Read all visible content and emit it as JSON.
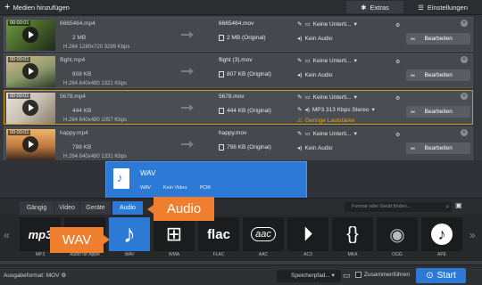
{
  "toolbar": {
    "add_media_label": "Medien hinzufügen",
    "extras_label": "Extras",
    "settings_label": "Einstellungen"
  },
  "files": [
    {
      "duration": "00:00:01",
      "source_name": "6665464.mp4",
      "source_size": "2 MB",
      "source_info": "H.264 1280x720 3299 Kbps",
      "output_name": "6665464.mov",
      "output_size": "2 MB (Original)",
      "subtitle": "Keine Unterti...",
      "audio": "Kein Audio",
      "edit_label": "Bearbeiten",
      "thumb_colors": [
        "#6f9a3a",
        "#1d2a1a"
      ]
    },
    {
      "duration": "00:00:01",
      "source_name": "flight.mp4",
      "source_size": "808 KB",
      "source_info": "H.264 640x480 1321 Kbps",
      "output_name": "flight (3).mov",
      "output_size": "807 KB (Original)",
      "subtitle": "Keine Unterti...",
      "audio": "Kein Audio",
      "edit_label": "Bearbeiten",
      "thumb_colors": [
        "#d7b88a",
        "#2c3b2a"
      ]
    },
    {
      "duration": "00:00:01",
      "source_name": "5678.mp4",
      "source_size": "444 KB",
      "source_info": "H.264 640x480 1057 Kbps",
      "output_name": "5678.mov",
      "output_size": "444 KB (Original)",
      "subtitle": "Keine Unterti...",
      "audio": "MP3 313 Kbps Stereo",
      "warning": "Geringe Lautstärke",
      "edit_label": "Bearbeiten",
      "thumb_colors": [
        "#e9e4dc",
        "#8a7a6a"
      ]
    },
    {
      "duration": "00:00:01",
      "source_name": "happy.mp4",
      "source_size": "798 KB",
      "source_info": "H.264 640x480 1331 Kbps",
      "output_name": "happy.mov",
      "output_size": "798 KB (Original)",
      "subtitle": "Keine Unterti...",
      "audio": "Kein Audio",
      "edit_label": "Bearbeiten",
      "thumb_colors": [
        "#f0b36a",
        "#3b2a20"
      ]
    }
  ],
  "popup": {
    "title": "WAV",
    "detail_1": "WAV",
    "detail_2": "Kein Video",
    "detail_3": "PCM"
  },
  "tabs": [
    {
      "label": "Gängig"
    },
    {
      "label": "Video"
    },
    {
      "label": "Geräte"
    },
    {
      "label": "Audio"
    }
  ],
  "search_placeholder": "Format oder Gerät finden...",
  "formats": [
    {
      "name": "mp3-icon",
      "label": "MP3"
    },
    {
      "name": "apple-audio-icon",
      "label": "Audio für Apple"
    },
    {
      "name": "wav-icon",
      "label": "WAV"
    },
    {
      "name": "wma-icon",
      "label": "WMA"
    },
    {
      "name": "flac-icon",
      "label": "FLAC"
    },
    {
      "name": "aac-icon",
      "label": "AAC"
    },
    {
      "name": "ac3-icon",
      "label": "AC3"
    },
    {
      "name": "mka-icon",
      "label": "MKA"
    },
    {
      "name": "ogg-icon",
      "label": "OGG"
    },
    {
      "name": "ape-icon",
      "label": "APE"
    }
  ],
  "callouts": {
    "audio": "Audio",
    "wav": "WAV"
  },
  "bottom": {
    "output_format": "Ausgabeformat: MOV",
    "save_path": "Speicherpfad...",
    "merge_label": "Zusammenführen",
    "start_label": "Start"
  },
  "colors": {
    "accent_blue": "#2d7ad6",
    "callout_orange": "#ef7f2f",
    "selected_border": "#c99b1e",
    "warning": "#e0a020"
  }
}
